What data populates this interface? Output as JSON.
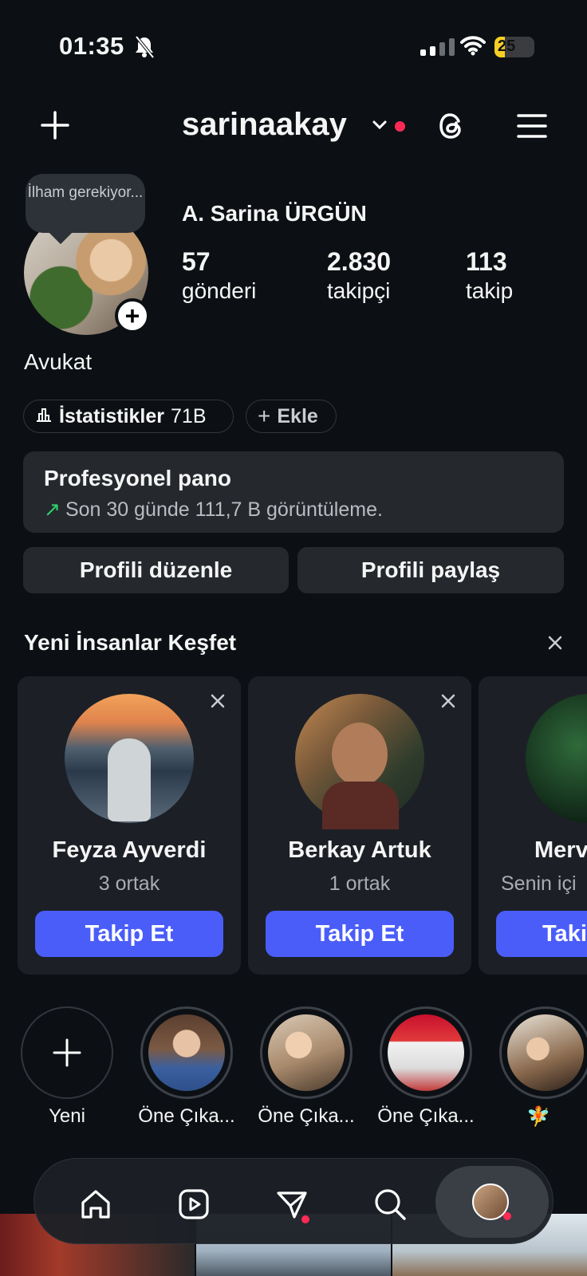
{
  "status_bar": {
    "time": "01:35",
    "battery": "25",
    "battery_level": 0.25
  },
  "header": {
    "username": "sarinaakay"
  },
  "profile": {
    "note_bubble": "İlham gerekiyor...",
    "full_name": "A. Sarina ÜRGÜN",
    "stats": [
      {
        "value": "57",
        "label": "gönderi"
      },
      {
        "value": "2.830",
        "label": "takipçi"
      },
      {
        "value": "113",
        "label": "takip"
      }
    ],
    "bio": "Avukat",
    "insights_label": "İstatistikler",
    "insights_count": "71B",
    "add_label": "Ekle"
  },
  "pro_dashboard": {
    "title": "Profesyonel pano",
    "subtitle": "Son 30 günde 111,7 B görüntüleme."
  },
  "buttons": {
    "edit": "Profili düzenle",
    "share": "Profili paylaş"
  },
  "discover": {
    "title": "Yeni İnsanlar Keşfet",
    "people": [
      {
        "name": "Feyza Ayverdi",
        "sub": "3 ortak",
        "action": "Takip Et"
      },
      {
        "name": "Berkay Artuk",
        "sub": "1 ortak",
        "action": "Takip Et"
      },
      {
        "name": "Merv",
        "sub": "Senin içi",
        "action": "Taki"
      }
    ]
  },
  "highlights": {
    "new_label": "Yeni",
    "items": [
      {
        "label": "Öne Çıka..."
      },
      {
        "label": "Öne Çıka..."
      },
      {
        "label": "Öne Çıka..."
      },
      {
        "label": "🧚"
      }
    ]
  },
  "icons": {
    "create": "plus-icon",
    "threads": "threads-icon",
    "menu": "hamburger-icon",
    "nav": [
      "home-icon",
      "reels-icon",
      "direct-icon",
      "search-icon",
      "profile-avatar"
    ]
  },
  "colors": {
    "background": "#0c1014",
    "card": "#25292e",
    "follow": "#4a5df9",
    "notification": "#ff2a55",
    "growth": "#2fd06b"
  }
}
